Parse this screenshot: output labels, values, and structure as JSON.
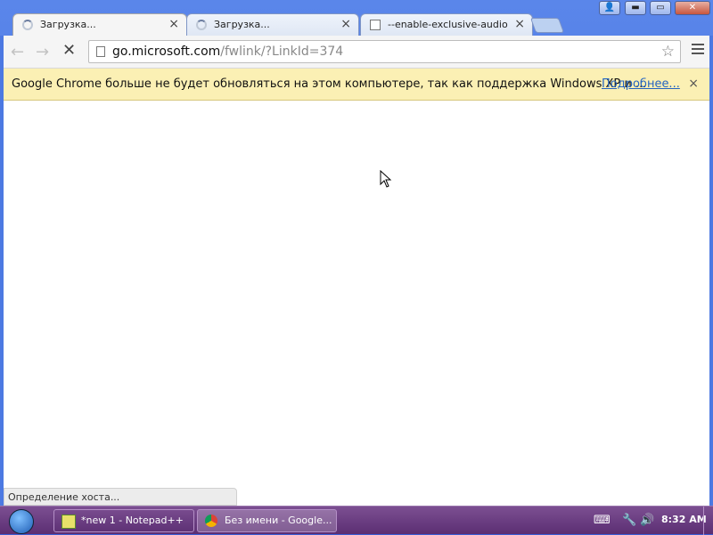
{
  "tabs": [
    {
      "title": "Загрузка...",
      "icon": "loading-spinner-icon",
      "active": true
    },
    {
      "title": "Загрузка...",
      "icon": "loading-spinner-icon",
      "active": false
    },
    {
      "title": "--enable-exclusive-audio",
      "icon": "page-icon",
      "active": false
    }
  ],
  "tab_close_glyph": "×",
  "window_controls": {
    "user": "👤",
    "minimize": "▬",
    "maximize": "▭",
    "close": "✕"
  },
  "toolbar": {
    "back": "←",
    "forward": "→",
    "stop": "✕",
    "url_host": "go.microsoft.com",
    "url_path": "/fwlink/?LinkId=374",
    "star": "☆"
  },
  "infobar": {
    "message": "Google Chrome больше не будет обновляться на этом компьютере, так как поддержка Windows XP и ...",
    "link": "Подробнее...",
    "close": "×"
  },
  "status_bubble": "Определение хоста...",
  "taskbar": {
    "items": [
      {
        "label": "*new 1 - Notepad++",
        "icon": "notepadpp-icon",
        "active": false
      },
      {
        "label": "Без имени - Google...",
        "icon": "chrome-icon",
        "active": true
      }
    ],
    "clock": "8:32 AM"
  },
  "colors": {
    "infobar_bg": "#fbf0b4",
    "link": "#2464c1",
    "taskbar": "#6a3b82",
    "window_frame": "#4c79e2"
  }
}
